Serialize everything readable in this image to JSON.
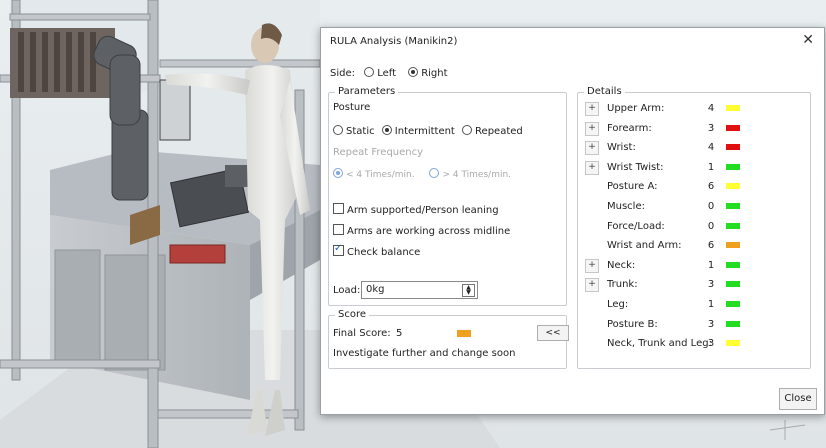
{
  "dialog": {
    "title": "RULA Analysis (Manikin2)",
    "close_glyph": "✕",
    "side_label": "Side:",
    "side_left": "Left",
    "side_right": "Right",
    "parameters_label": "Parameters",
    "posture_label": "Posture",
    "posture_static": "Static",
    "posture_intermittent": "Intermittent",
    "posture_repeated": "Repeated",
    "repeat_freq_label": "Repeat Frequency",
    "freq_low": "< 4 Times/min.",
    "freq_high": "> 4 Times/min.",
    "arm_supported": "Arm supported/Person leaning",
    "arms_midline": "Arms are working across midline",
    "check_balance": "Check balance",
    "load_label": "Load:",
    "load_value": "0kg",
    "score_label": "Score",
    "final_score_label": "Final Score:",
    "final_score_value": "5",
    "final_score_color": "#f0a020",
    "collapse_button": "<<",
    "score_message": "Investigate further and change soon",
    "details_label": "Details",
    "close_button": "Close",
    "details": [
      {
        "expand": true,
        "label": "Upper Arm:",
        "value": "4",
        "color": "#ffff33"
      },
      {
        "expand": true,
        "label": "Forearm:",
        "value": "3",
        "color": "#e01010"
      },
      {
        "expand": true,
        "label": "Wrist:",
        "value": "4",
        "color": "#e01010"
      },
      {
        "expand": true,
        "label": "Wrist Twist:",
        "value": "1",
        "color": "#22dd22"
      },
      {
        "expand": false,
        "label": "Posture A:",
        "value": "6",
        "color": "#ffff33"
      },
      {
        "expand": false,
        "label": "Muscle:",
        "value": "0",
        "color": "#22dd22"
      },
      {
        "expand": false,
        "label": "Force/Load:",
        "value": "0",
        "color": "#22dd22"
      },
      {
        "expand": false,
        "label": "Wrist and Arm:",
        "value": "6",
        "color": "#f0a020"
      },
      {
        "expand": true,
        "label": "Neck:",
        "value": "1",
        "color": "#22dd22"
      },
      {
        "expand": true,
        "label": "Trunk:",
        "value": "3",
        "color": "#22dd22"
      },
      {
        "expand": false,
        "label": "Leg:",
        "value": "1",
        "color": "#22dd22"
      },
      {
        "expand": false,
        "label": "Posture B:",
        "value": "3",
        "color": "#22dd22"
      },
      {
        "expand": false,
        "label": "Neck, Trunk and Leg:",
        "value": "3",
        "color": "#ffff33"
      }
    ],
    "plus_glyph": "+"
  }
}
